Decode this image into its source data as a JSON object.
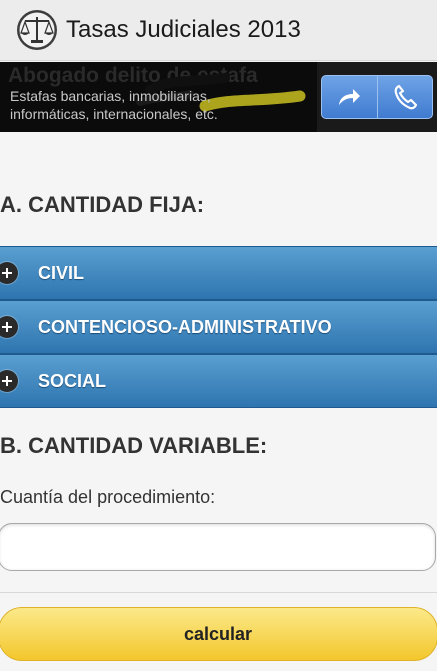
{
  "app": {
    "title": "Tasas Judiciales 2013",
    "icon": "scales-of-justice-icon"
  },
  "ad": {
    "headline": "Abogado delito de estafa",
    "body_line1": "Estafas bancarias, inmobiliarias,",
    "body_line2": "informáticas, internacionales, etc.",
    "buttons": [
      "share-arrow-icon",
      "phone-icon"
    ]
  },
  "section_a": {
    "title": "A. CANTIDAD FIJA:",
    "items": [
      {
        "label": "CIVIL",
        "icon": "plus-icon"
      },
      {
        "label": "CONTENCIOSO-ADMINISTRATIVO",
        "icon": "plus-icon"
      },
      {
        "label": "SOCIAL",
        "icon": "plus-icon"
      }
    ]
  },
  "section_b": {
    "title": "B. CANTIDAD VARIABLE:",
    "field_label": "Cuantía del procedimiento:",
    "field_value": "",
    "button_label": "calcular"
  },
  "colors": {
    "accordion": "#3f86c0",
    "button": "#f5d24a",
    "ad_buttons": "#4f8bda"
  }
}
